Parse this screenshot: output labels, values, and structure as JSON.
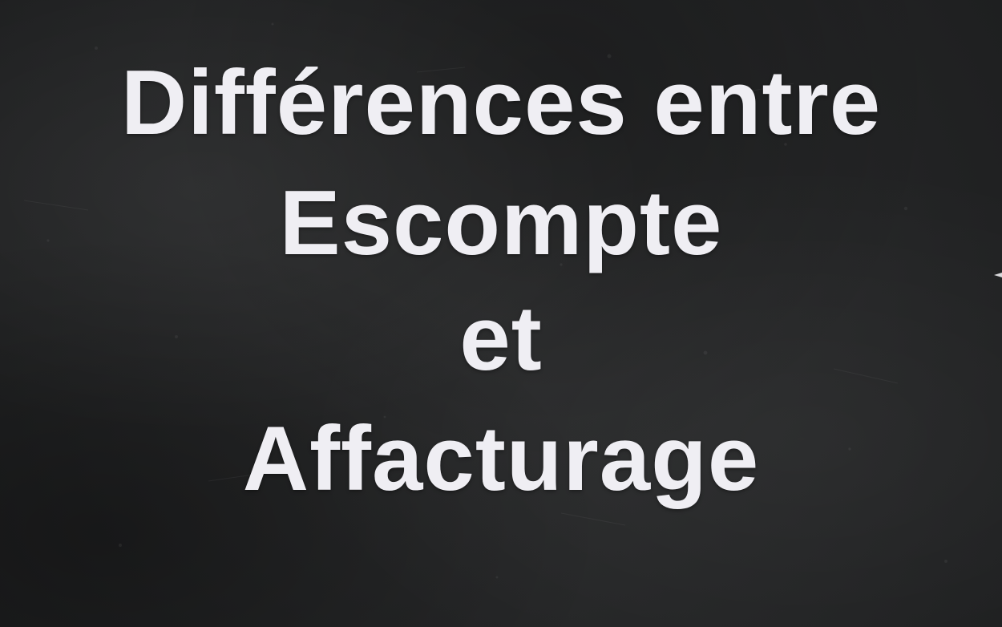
{
  "title": {
    "lines": [
      "Différences entre",
      "Escompte",
      "et",
      "Affacturage"
    ]
  },
  "colors": {
    "background": "#232425",
    "text": "#efeef3"
  }
}
